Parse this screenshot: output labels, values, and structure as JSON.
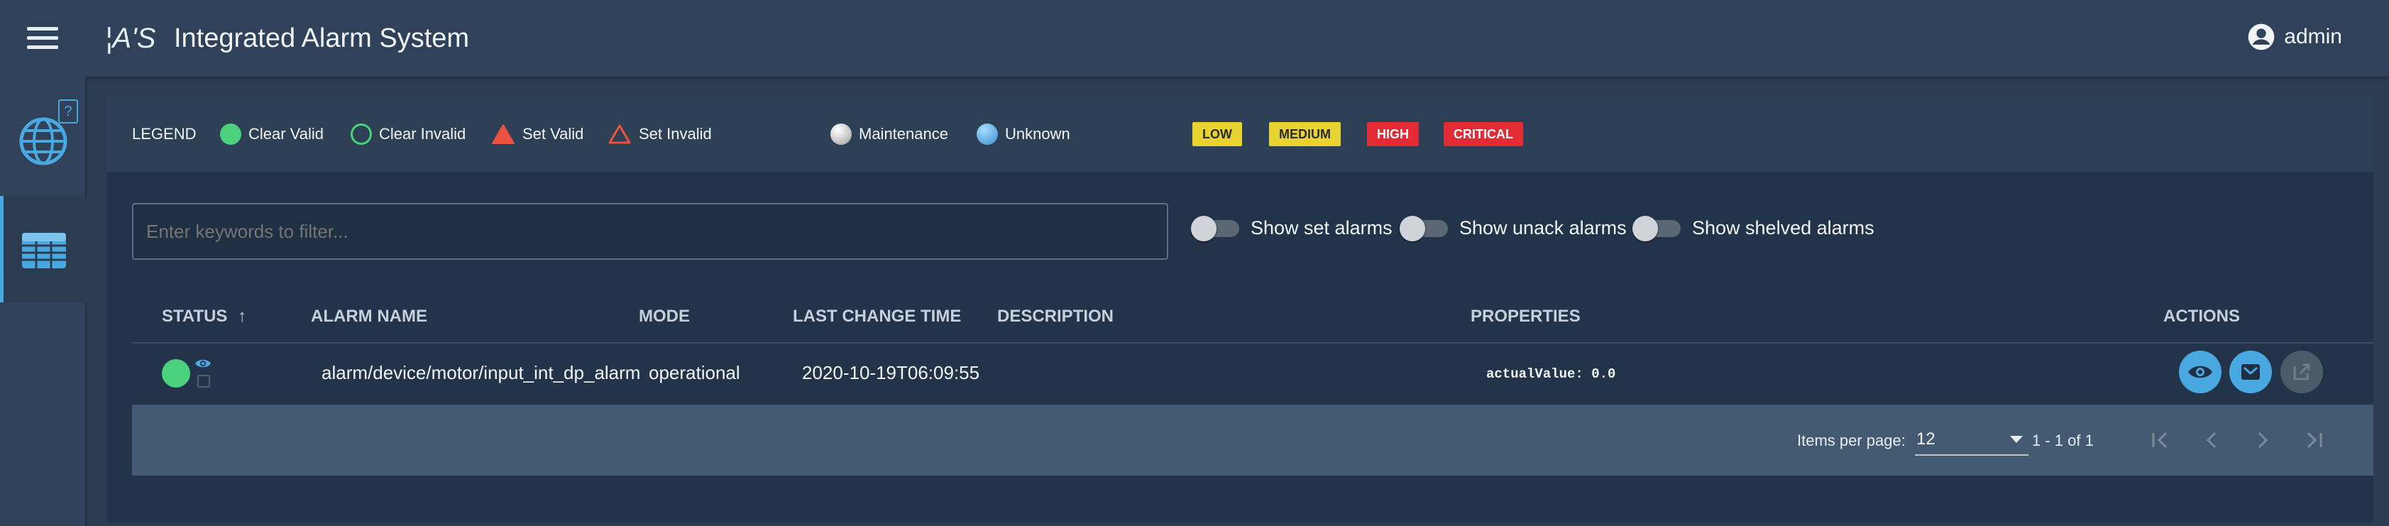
{
  "header": {
    "logo": "¦A'S",
    "title": "Integrated Alarm System",
    "user": "admin"
  },
  "sidebar": {
    "help_badge": "?"
  },
  "legend": {
    "title": "LEGEND",
    "items": [
      {
        "label": "Clear Valid",
        "color": "#4cd17c"
      },
      {
        "label": "Clear Invalid",
        "color": "#4cd17c"
      },
      {
        "label": "Set Valid",
        "color": "#e8523f"
      },
      {
        "label": "Set Invalid",
        "color": "#e8523f"
      },
      {
        "label": "Maintenance",
        "color": "#d9d9d9"
      },
      {
        "label": "Unknown",
        "color": "#63b6ea"
      }
    ],
    "priorities": [
      {
        "label": "LOW",
        "bg": "#e8d430",
        "fg": "#2b2b2b"
      },
      {
        "label": "MEDIUM",
        "bg": "#e8d430",
        "fg": "#2b2b2b"
      },
      {
        "label": "HIGH",
        "bg": "#e22b35",
        "fg": "#ffffff"
      },
      {
        "label": "CRITICAL",
        "bg": "#e22b35",
        "fg": "#ffffff"
      }
    ]
  },
  "filter": {
    "placeholder": "Enter keywords to filter..."
  },
  "toggles": [
    {
      "label": "Show set alarms",
      "on": false
    },
    {
      "label": "Show unack alarms",
      "on": false
    },
    {
      "label": "Show shelved alarms",
      "on": false
    }
  ],
  "table": {
    "columns": {
      "status": "STATUS",
      "sort_indicator": "↑",
      "name": "ALARM NAME",
      "mode": "MODE",
      "time": "LAST CHANGE TIME",
      "description": "DESCRIPTION",
      "properties": "PROPERTIES",
      "actions": "ACTIONS"
    },
    "rows": [
      {
        "status": "Clear Valid",
        "name": "alarm/device/motor/input_int_dp_alarm",
        "mode": "operational",
        "time": "2020-10-19T06:09:55",
        "description": "",
        "properties": "actualValue: 0.0"
      }
    ]
  },
  "paginator": {
    "items_per_page_label": "Items per page:",
    "items_per_page_value": "12",
    "range": "1 - 1 of 1"
  },
  "icons": {
    "menu": "menu-icon",
    "user": "account-circle-icon",
    "globe": "globe-icon",
    "table": "table-icon",
    "eye": "eye-icon",
    "ack": "ack-icon",
    "external": "external-link-icon"
  },
  "colors": {
    "accent": "#4aa8e0",
    "toolbar": "#2f4259",
    "background": "#2b3c50"
  }
}
